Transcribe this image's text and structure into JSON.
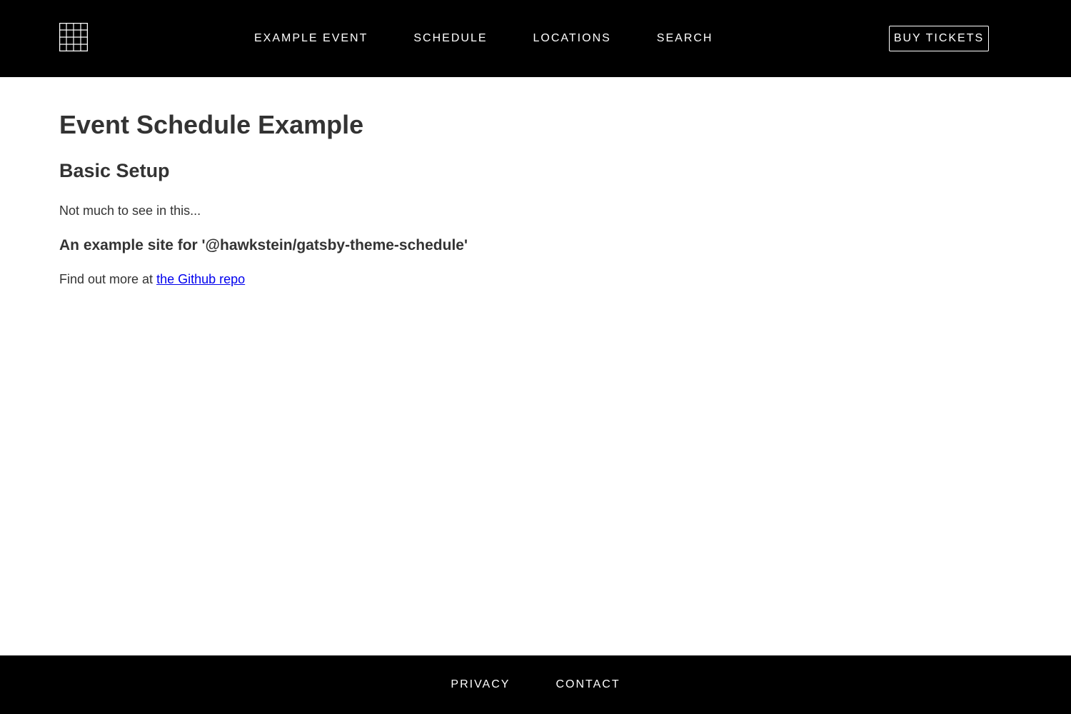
{
  "header": {
    "logo_icon": "grid-icon",
    "nav": [
      {
        "label": "EXAMPLE EVENT"
      },
      {
        "label": "SCHEDULE"
      },
      {
        "label": "LOCATIONS"
      },
      {
        "label": "SEARCH"
      }
    ],
    "buy_tickets_label": "BUY TICKETS"
  },
  "main": {
    "title": "Event Schedule Example",
    "section_title": "Basic Setup",
    "intro": "Not much to see in this...",
    "subtitle": "An example site for '@hawkstein/gatsby-theme-schedule'",
    "more_prefix": "Find out more at ",
    "more_link_label": "the Github repo"
  },
  "footer": {
    "links": [
      {
        "label": "PRIVACY"
      },
      {
        "label": "CONTACT"
      }
    ]
  },
  "colors": {
    "bar_background": "#000000",
    "bar_text": "#ffffff",
    "body_text": "#333333",
    "link": "#0000ee"
  }
}
